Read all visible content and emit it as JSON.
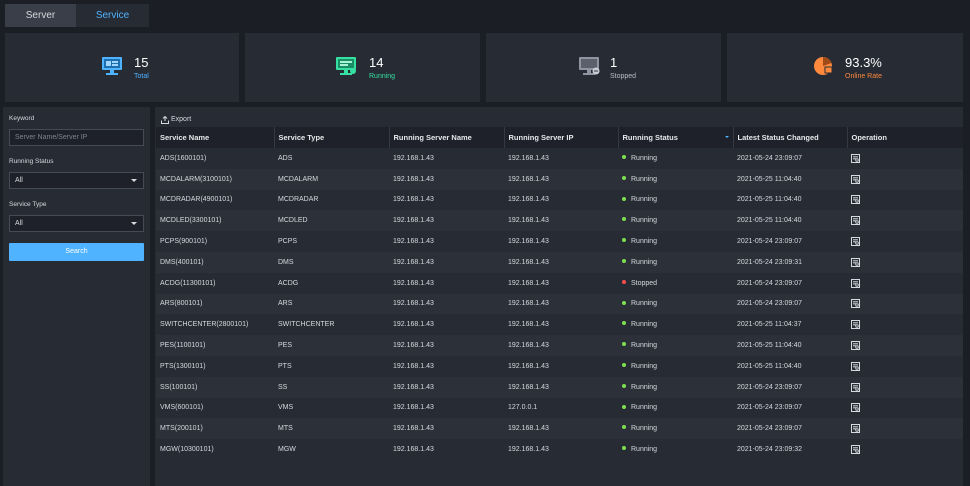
{
  "tabs": {
    "server": "Server",
    "service": "Service"
  },
  "stats": {
    "total": {
      "value": "15",
      "label": "Total",
      "color": "#4fb3ff"
    },
    "running": {
      "value": "14",
      "label": "Running",
      "color": "#35e0a1"
    },
    "stopped": {
      "value": "1",
      "label": "Stopped",
      "color": "#b9bec7"
    },
    "online": {
      "value": "93.3%",
      "label": "Online Rate",
      "color": "#ff8a3d"
    }
  },
  "filter": {
    "keyword_label": "Keyword",
    "keyword_placeholder": "Server Name/Server IP",
    "status_label": "Running Status",
    "status_value": "All",
    "type_label": "Service Type",
    "type_value": "All",
    "search_label": "Search"
  },
  "toolbar": {
    "export_label": "Export"
  },
  "table": {
    "columns": [
      "Service Name",
      "Service Type",
      "Running Server Name",
      "Running Server IP",
      "Running Status",
      "Latest Status Changed",
      "Operation"
    ],
    "rows": [
      {
        "name": "ADS(1600101)",
        "type": "ADS",
        "server": "192.168.1.43",
        "ip": "192.168.1.43",
        "status": "Running",
        "changed": "2021-05-24 23:09:07"
      },
      {
        "name": "MCDALARM(3100101)",
        "type": "MCDALARM",
        "server": "192.168.1.43",
        "ip": "192.168.1.43",
        "status": "Running",
        "changed": "2021-05-25 11:04:40"
      },
      {
        "name": "MCDRADAR(4900101)",
        "type": "MCDRADAR",
        "server": "192.168.1.43",
        "ip": "192.168.1.43",
        "status": "Running",
        "changed": "2021-05-25 11:04:40"
      },
      {
        "name": "MCDLED(3300101)",
        "type": "MCDLED",
        "server": "192.168.1.43",
        "ip": "192.168.1.43",
        "status": "Running",
        "changed": "2021-05-25 11:04:40"
      },
      {
        "name": "PCPS(900101)",
        "type": "PCPS",
        "server": "192.168.1.43",
        "ip": "192.168.1.43",
        "status": "Running",
        "changed": "2021-05-24 23:09:07"
      },
      {
        "name": "DMS(400101)",
        "type": "DMS",
        "server": "192.168.1.43",
        "ip": "192.168.1.43",
        "status": "Running",
        "changed": "2021-05-24 23:09:31"
      },
      {
        "name": "ACDG(11300101)",
        "type": "ACDG",
        "server": "192.168.1.43",
        "ip": "192.168.1.43",
        "status": "Stopped",
        "changed": "2021-05-24 23:09:07"
      },
      {
        "name": "ARS(800101)",
        "type": "ARS",
        "server": "192.168.1.43",
        "ip": "192.168.1.43",
        "status": "Running",
        "changed": "2021-05-24 23:09:07"
      },
      {
        "name": "SWITCHCENTER(2800101)",
        "type": "SWITCHCENTER",
        "server": "192.168.1.43",
        "ip": "192.168.1.43",
        "status": "Running",
        "changed": "2021-05-25 11:04:37"
      },
      {
        "name": "PES(1100101)",
        "type": "PES",
        "server": "192.168.1.43",
        "ip": "192.168.1.43",
        "status": "Running",
        "changed": "2021-05-25 11:04:40"
      },
      {
        "name": "PTS(1300101)",
        "type": "PTS",
        "server": "192.168.1.43",
        "ip": "192.168.1.43",
        "status": "Running",
        "changed": "2021-05-25 11:04:40"
      },
      {
        "name": "SS(100101)",
        "type": "SS",
        "server": "192.168.1.43",
        "ip": "192.168.1.43",
        "status": "Running",
        "changed": "2021-05-24 23:09:07"
      },
      {
        "name": "VMS(600101)",
        "type": "VMS",
        "server": "192.168.1.43",
        "ip": "127.0.0.1",
        "status": "Running",
        "changed": "2021-05-24 23:09:07"
      },
      {
        "name": "MTS(200101)",
        "type": "MTS",
        "server": "192.168.1.43",
        "ip": "192.168.1.43",
        "status": "Running",
        "changed": "2021-05-24 23:09:07"
      },
      {
        "name": "MGW(10300101)",
        "type": "MGW",
        "server": "192.168.1.43",
        "ip": "192.168.1.43",
        "status": "Running",
        "changed": "2021-05-24 23:09:32"
      }
    ]
  },
  "status_colors": {
    "Running": "#7ee04f",
    "Stopped": "#ff4d4f"
  },
  "icons": {
    "operation": "details-icon",
    "export": "export-icon"
  }
}
